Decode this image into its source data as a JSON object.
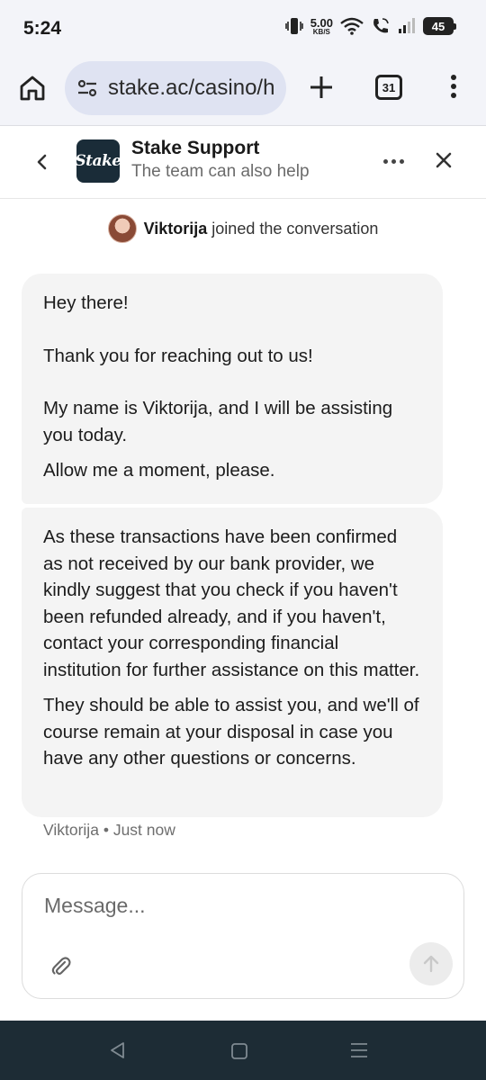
{
  "status_bar": {
    "time": "5:24",
    "speed_value": "5.00",
    "speed_unit": "KB/S",
    "battery": "45",
    "icons": [
      "vibrate-icon",
      "wifi-icon",
      "wifi-calling-icon",
      "signal-icon",
      "battery-icon"
    ]
  },
  "browser": {
    "url": "stake.ac/casino/h",
    "tab_count": "31",
    "icons": [
      "home-icon",
      "site-settings-icon",
      "plus-icon",
      "tabs-icon",
      "more-vert-icon"
    ]
  },
  "chat_header": {
    "logo_text": "Stake",
    "title": "Stake Support",
    "subtitle": "The team can also help",
    "icons": [
      "chevron-left-icon",
      "more-horiz-icon",
      "close-icon"
    ]
  },
  "joined_notice": {
    "name": "Viktorija",
    "text": "joined the conversation"
  },
  "messages": [
    {
      "paragraphs": [
        "Hey there!",
        "Thank you for reaching out to us!",
        "My name is Viktorija, and I will be assisting you today.",
        "Allow me a moment, please."
      ]
    },
    {
      "paragraphs": [
        "As these transactions have been confirmed as not received by our bank provider, we kindly suggest that you check if you haven't been refunded already, and if you haven't, contact your corresponding financial institution for further assistance on this matter.",
        "They should be able to assist you, and we'll of course remain at your disposal in case you have any other questions or concerns."
      ]
    }
  ],
  "message_meta": {
    "author": "Viktorija",
    "separator": "•",
    "time": "Just now"
  },
  "composer": {
    "placeholder": "Message...",
    "value": "",
    "icons": [
      "paperclip-icon",
      "arrow-up-icon"
    ]
  },
  "nav_bar": {
    "icons": [
      "nav-back-icon",
      "nav-home-icon",
      "nav-recents-icon"
    ]
  },
  "colors": {
    "chrome_bg": "#f3f4f9",
    "url_pill": "#dfe3f2",
    "logo_bg": "#1a2c38",
    "bubble_bg": "#f4f4f4",
    "nav_bg": "#1d2c35"
  }
}
